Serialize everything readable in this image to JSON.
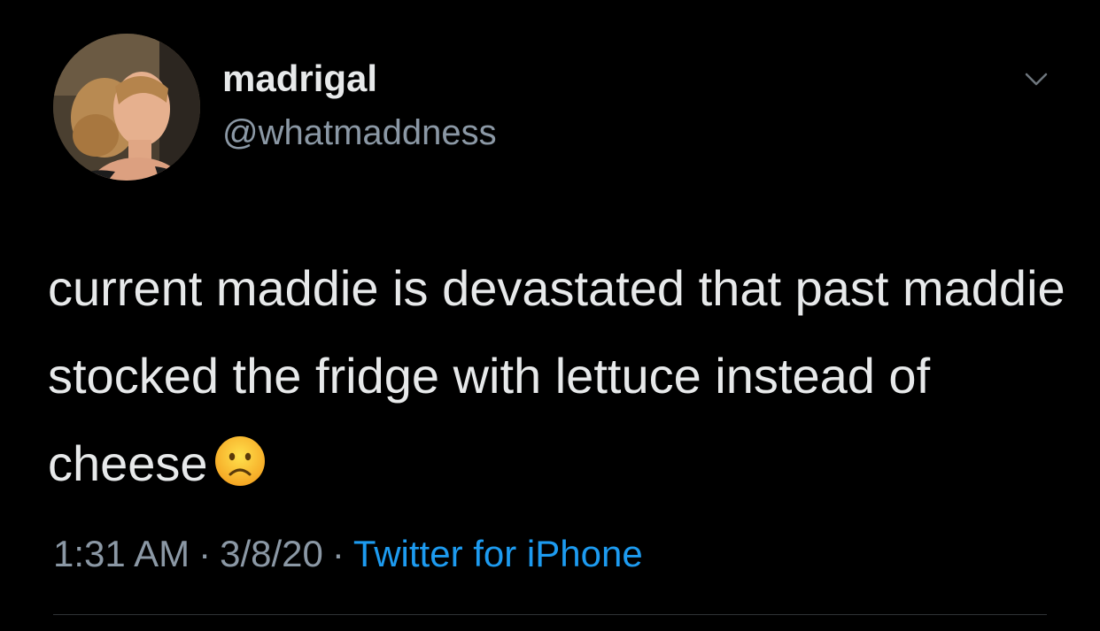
{
  "tweet": {
    "display_name": "madrigal",
    "handle": "@whatmaddness",
    "text": "current maddie is devastated that past maddie stocked the fridge with lettuce instead of cheese",
    "emoji": "frowning-face",
    "time": "1:31 AM",
    "separator": "·",
    "date": "3/8/20",
    "source": "Twitter for iPhone"
  },
  "icons": {
    "more": "chevron-down-icon",
    "avatar": "profile-photo"
  },
  "colors": {
    "background": "#000000",
    "primary_text": "#e7e9ea",
    "secondary_text": "#8b98a5",
    "link": "#1d9bf0",
    "divider": "#2f3336"
  }
}
